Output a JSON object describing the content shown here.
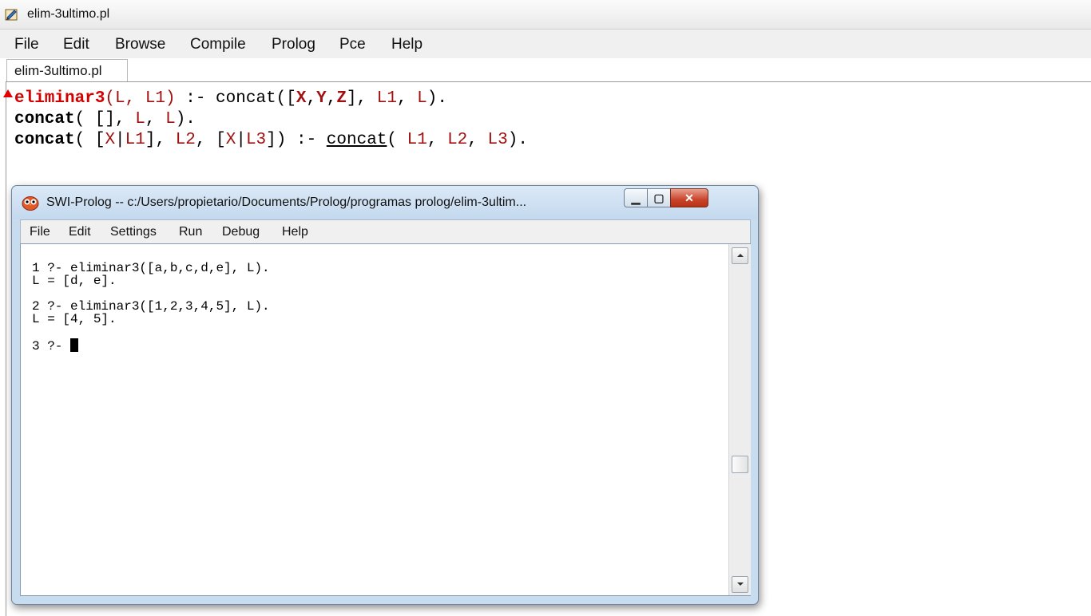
{
  "window": {
    "title": "elim-3ultimo.pl"
  },
  "menu": [
    "File",
    "Edit",
    "Browse",
    "Compile",
    "Prolog",
    "Pce",
    "Help"
  ],
  "tab": {
    "label": "elim-3ultimo.pl"
  },
  "code": {
    "line1": {
      "head": "eliminar3",
      "args": "(L, L1)",
      "neck": " :- concat([X,Y,Z], L1, L)."
    },
    "line2": {
      "head": "concat",
      "rest": "( [], L, L)."
    },
    "line3": {
      "head": "concat",
      "args": "( [X|L1], L2, [X|L3]) :- ",
      "call": "concat",
      "rest": "( L1, L2, L3)."
    }
  },
  "swi": {
    "title": "SWI-Prolog -- c:/Users/propietario/Documents/Prolog/programas prolog/elim-3ultim...",
    "menu": [
      "File",
      "Edit",
      "Settings",
      "Run",
      "Debug",
      "Help"
    ],
    "console_lines": [
      "1 ?- eliminar3([a,b,c,d,e], L).",
      "L = [d, e].",
      "",
      "2 ?- eliminar3([1,2,3,4,5], L).",
      "L = [4, 5].",
      "",
      "3 ?- "
    ]
  },
  "colors": {
    "defined_predicate": "#d40000",
    "variable": "#a01010",
    "titlebar": "#c4d9ee"
  }
}
